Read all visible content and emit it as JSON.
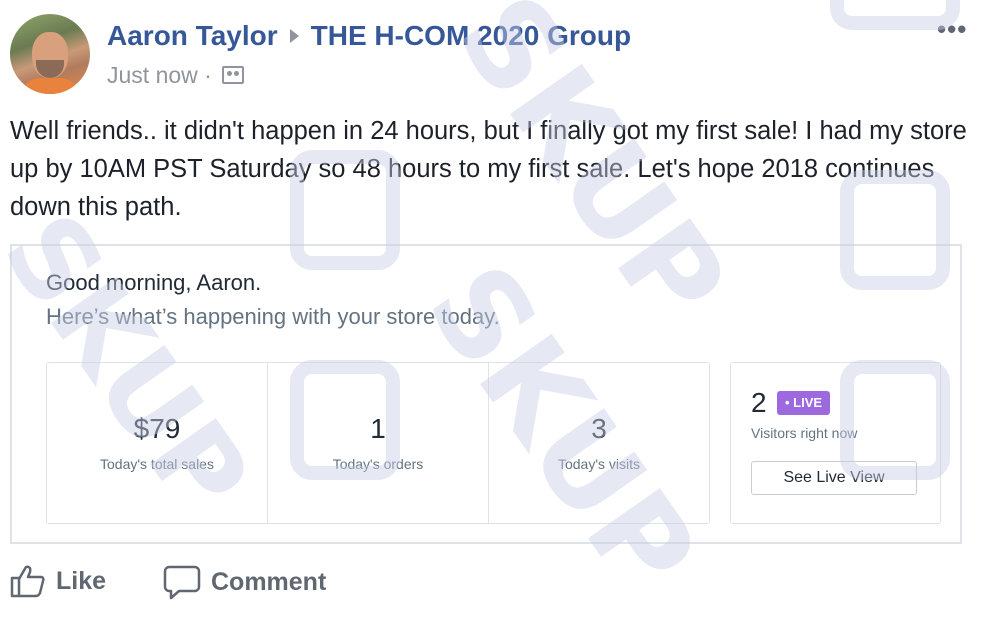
{
  "post": {
    "author": "Aaron Taylor",
    "group": "THE H-COM 2020 Group",
    "timestamp": "Just now",
    "separator": "·",
    "text": "Well friends.. it didn't happen in 24 hours, but I finally got my first sale! I had my store up by 10AM PST Saturday so 48 hours to my first sale. Let's hope 2018 continues down this path.",
    "more_icon": "more-horizontal-icon",
    "audience_icon": "group-audience-icon"
  },
  "dashboard": {
    "greeting": "Good morning, Aaron.",
    "subtitle": "Here’s what’s happening with your store today.",
    "stats": [
      {
        "value": "$79",
        "label": "Today's total sales"
      },
      {
        "value": "1",
        "label": "Today's orders"
      },
      {
        "value": "3",
        "label": "Today's visits"
      }
    ],
    "live": {
      "count": "2",
      "badge": "• LIVE",
      "label": "Visitors right now",
      "button": "See Live View",
      "badge_color": "#9c6ade"
    }
  },
  "actions": {
    "like": "Like",
    "comment": "Comment"
  },
  "watermark": "SKUP",
  "colors": {
    "link": "#365899",
    "meta": "#90949c",
    "action": "#606770"
  }
}
